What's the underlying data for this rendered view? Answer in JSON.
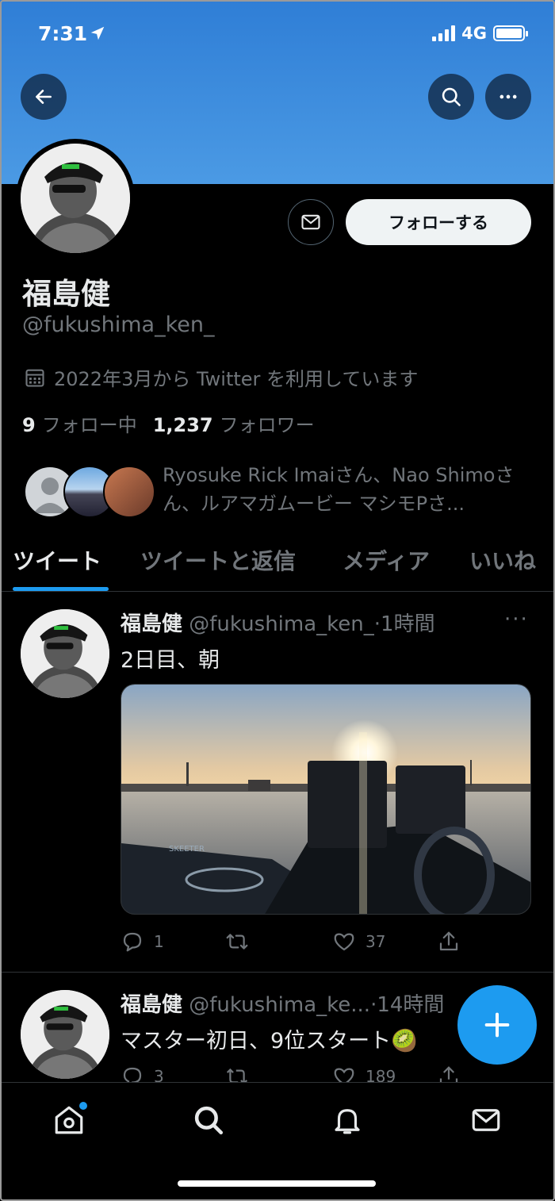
{
  "status_bar": {
    "time": "7:31",
    "network": "4G"
  },
  "profile": {
    "display_name": "福島健",
    "handle": "@fukushima_ken_",
    "joined": "2022年3月から Twitter を利用しています",
    "following_count": "9",
    "following_label": "フォロー中",
    "followers_count": "1,237",
    "followers_label": "フォロワー",
    "followed_by_text": "Ryosuke Rick Imaiさん、Nao Shimoさん、ルアマガムービー マシモPさ...",
    "follow_button_label": "フォローする"
  },
  "tabs": [
    {
      "label": "ツイート",
      "active": true
    },
    {
      "label": "ツイートと返信",
      "active": false
    },
    {
      "label": "メディア",
      "active": false
    },
    {
      "label": "いいね",
      "active": false
    }
  ],
  "tweets": [
    {
      "name": "福島健",
      "handle": "@fukushima_ken_",
      "time": "·1時間",
      "text": "2日目、朝",
      "replies": "1",
      "retweets": "",
      "likes": "37"
    },
    {
      "name": "福島健",
      "handle": "@fukushima_ke...",
      "time": "·14時間",
      "text": "マスター初日、9位スタート🥝",
      "replies": "3",
      "retweets": "",
      "likes": "189"
    }
  ],
  "icons": {
    "back": "arrow-left-icon",
    "search": "search-icon",
    "more": "more-icon",
    "message": "mail-icon",
    "calendar": "calendar-icon",
    "reply": "reply-icon",
    "retweet": "retweet-icon",
    "like": "heart-icon",
    "share": "share-icon",
    "compose": "plus-icon",
    "home": "home-icon",
    "explore": "search-icon",
    "notifications": "bell-icon",
    "messages": "mail-icon"
  },
  "colors": {
    "accent": "#1d9bf0",
    "banner": "#3b8ddf",
    "background": "#000000",
    "muted": "#71767b"
  }
}
